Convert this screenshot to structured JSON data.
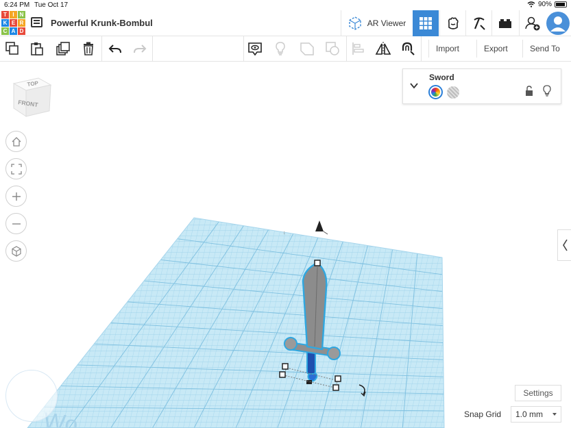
{
  "status_bar": {
    "time": "6:24 PM",
    "date": "Tue Oct 17",
    "battery": "90%",
    "wifi_icon": "wifi-icon",
    "battery_icon": "battery-icon"
  },
  "header": {
    "logo_letters": [
      "T",
      "I",
      "N",
      "K",
      "E",
      "R",
      "C",
      "A",
      "D"
    ],
    "logo_colors": [
      "#e8493a",
      "#f5a623",
      "#8bc34a",
      "#1e88e5",
      "#e8493a",
      "#f5a623",
      "#8bc34a",
      "#1e88e5",
      "#e8493a"
    ],
    "project_title": "Powerful Krunk-Bombul",
    "ar_viewer_label": "AR Viewer",
    "icons": [
      "3d-design-grid-icon",
      "blocks-icon",
      "bricks-pickaxe-icon",
      "lego-brick-icon",
      "add-user-icon",
      "avatar"
    ],
    "accent": "#3b89d6"
  },
  "toolbar": {
    "icons": [
      "copy-icon",
      "paste-icon",
      "duplicate-icon",
      "delete-icon",
      "undo-icon",
      "redo-icon",
      "notes-icon",
      "light-bulb-icon",
      "group-icon",
      "ungroup-icon",
      "align-icon",
      "mirror-icon",
      "cruise-magnet-icon"
    ],
    "import_label": "Import",
    "export_label": "Export",
    "send_to_label": "Send To"
  },
  "viewcube": {
    "top_label": "TOP",
    "front_label": "FRONT"
  },
  "nav": {
    "icons": [
      "home-icon",
      "fit-view-icon",
      "zoom-in-icon",
      "zoom-out-icon",
      "ortho-perspective-icon"
    ]
  },
  "shape_panel": {
    "title": "Sword",
    "solid_label": "Solid",
    "hole_label": "Hole",
    "icons": [
      "chevron-down-icon",
      "lock-icon",
      "light-bulb-icon"
    ]
  },
  "workplane": {
    "grid_color": "#bfe3f3",
    "line_color": "#89c6e4",
    "watermark": "Wo"
  },
  "bottom": {
    "settings_label": "Settings",
    "snap_grid_label": "Snap Grid",
    "snap_grid_value": "1.0 mm"
  }
}
